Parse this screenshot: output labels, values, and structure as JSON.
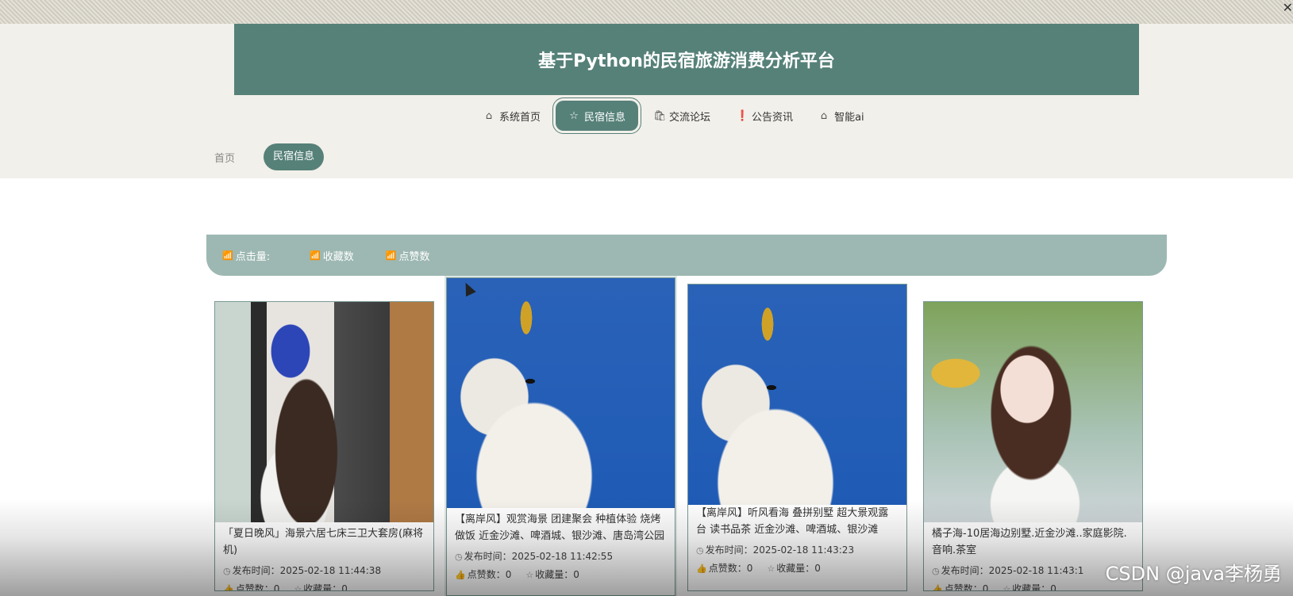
{
  "header": {
    "title": "基于Python的民宿旅游消费分析平台"
  },
  "nav": [
    {
      "label": "系统首页",
      "icon": "home-icon",
      "glyph": "⌂",
      "active": false
    },
    {
      "label": "民宿信息",
      "icon": "star-icon",
      "glyph": "☆",
      "active": true
    },
    {
      "label": "交流论坛",
      "icon": "bag-icon",
      "glyph": "🛍",
      "active": false
    },
    {
      "label": "公告资讯",
      "icon": "alert-circle-icon",
      "glyph": "❗",
      "active": false
    },
    {
      "label": "智能ai",
      "icon": "home-icon",
      "glyph": "⌂",
      "active": false
    }
  ],
  "breadcrumb": {
    "home": "首页",
    "current": "民宿信息"
  },
  "sortbar": {
    "items": [
      {
        "label": "点击量:",
        "icon": "chart-icon"
      },
      {
        "label": "收藏数",
        "icon": "chart-icon"
      },
      {
        "label": "点赞数",
        "icon": "chart-icon"
      }
    ]
  },
  "cards": [
    {
      "name": "「夏日晚风」海景六居七床三卫大套房(麻将机)",
      "time_label": "发布时间：",
      "time": "2025-02-18 11:44:38",
      "likes_label": "点赞数：",
      "likes": "0",
      "fav_label": "收藏量：",
      "fav": "0"
    },
    {
      "name": "【离岸风】观赏海景 团建聚会 种植体验 烧烤做饭 近金沙滩、啤酒城、银沙滩、唐岛湾公园",
      "time_label": "发布时间：",
      "time": "2025-02-18 11:42:55",
      "likes_label": "点赞数：",
      "likes": "0",
      "fav_label": "收藏量：",
      "fav": "0"
    },
    {
      "name": "【离岸风】听风看海 叠拼别墅 超大景观露台 读书品茶 近金沙滩、啤酒城、银沙滩",
      "time_label": "发布时间：",
      "time": "2025-02-18 11:43:23",
      "likes_label": "点赞数：",
      "likes": "0",
      "fav_label": "收藏量：",
      "fav": "0"
    },
    {
      "name": "橘子海-10居海边别墅.近金沙滩..家庭影院.音响.茶室",
      "time_label": "发布时间：",
      "time": "2025-02-18 11:43:1",
      "likes_label": "点赞数：",
      "likes": "0",
      "fav_label": "收藏量：",
      "fav": "0"
    }
  ],
  "watermark": "CSDN @java李杨勇"
}
